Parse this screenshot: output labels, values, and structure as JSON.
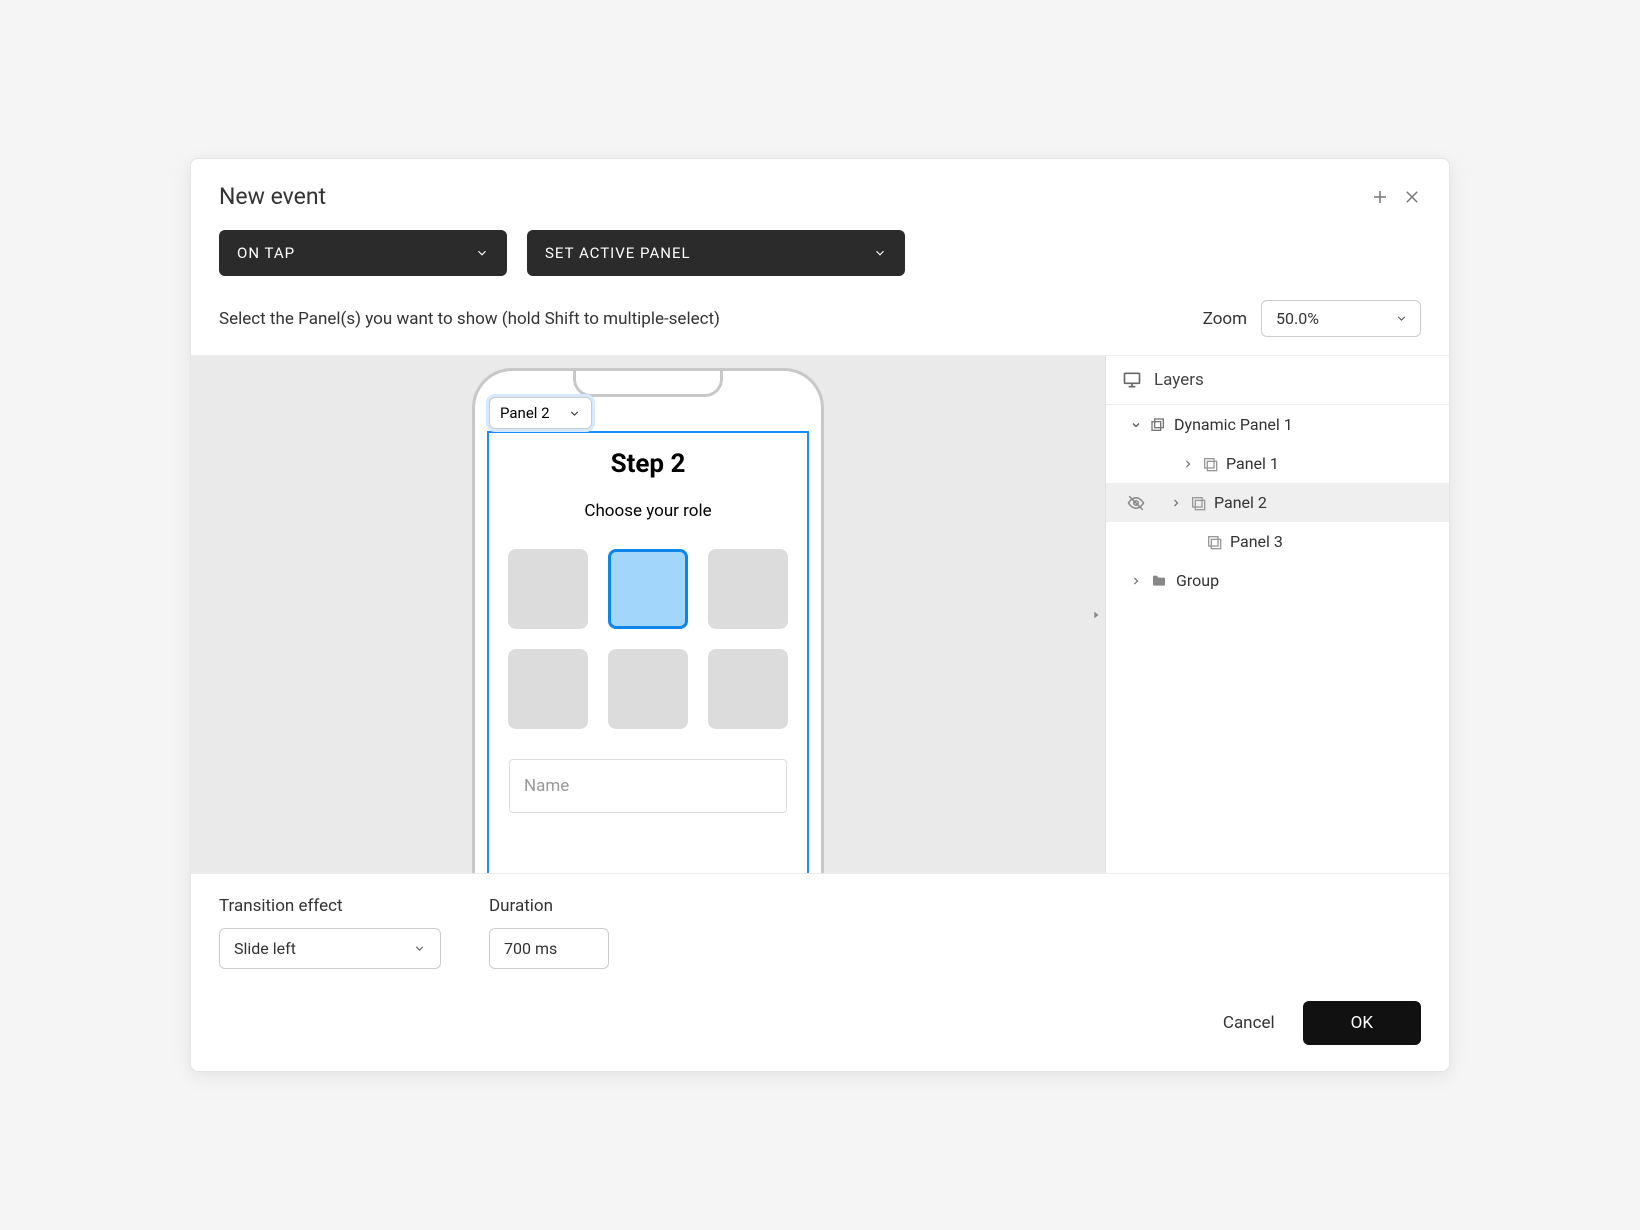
{
  "dialog": {
    "title": "New event"
  },
  "trigger": {
    "selected": "ON TAP"
  },
  "action": {
    "selected": "SET ACTIVE PANEL"
  },
  "instruction": "Select the Panel(s) you want to show (hold Shift to multiple-select)",
  "zoom": {
    "label": "Zoom",
    "value": "50.0%"
  },
  "canvas": {
    "panel_selector": "Panel 2",
    "step_title": "Step 2",
    "step_subtitle": "Choose your role",
    "name_placeholder": "Name"
  },
  "layers": {
    "title": "Layers",
    "items": {
      "dynamic_panel": "Dynamic Panel 1",
      "panel1": "Panel 1",
      "panel2": "Panel 2",
      "panel3": "Panel 3",
      "group": "Group"
    }
  },
  "transition": {
    "label": "Transition effect",
    "value": "Slide left"
  },
  "duration": {
    "label": "Duration",
    "value": "700 ms"
  },
  "footer": {
    "cancel": "Cancel",
    "ok": "OK"
  }
}
